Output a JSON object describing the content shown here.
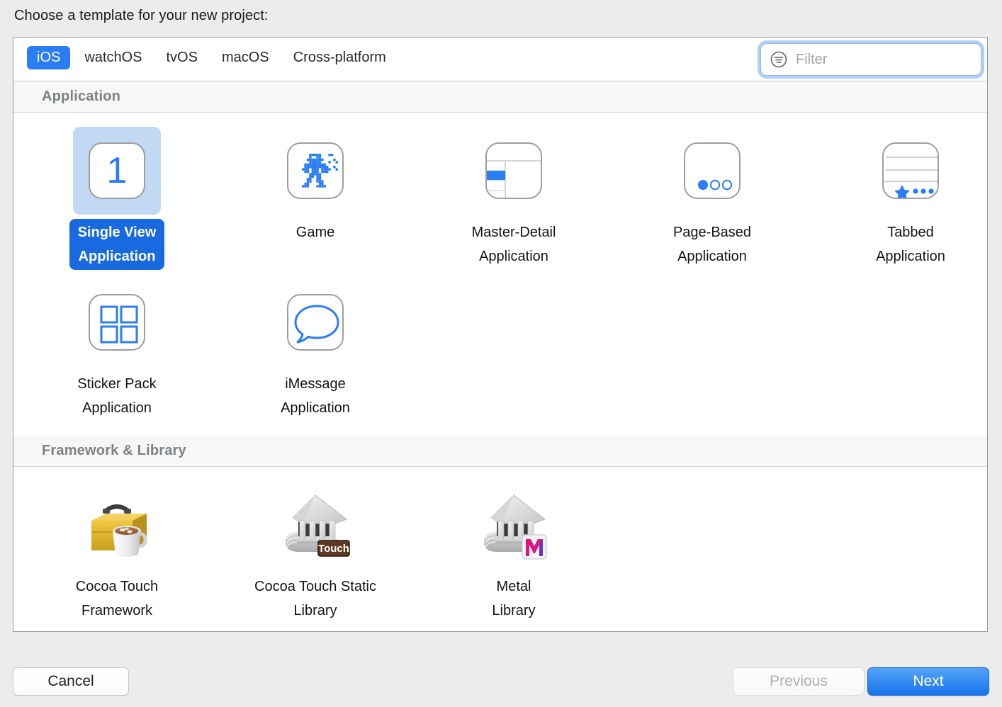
{
  "prompt": "Choose a template for your new project:",
  "toolbar": {
    "tabs": [
      {
        "label": "iOS",
        "active": true
      },
      {
        "label": "watchOS",
        "active": false
      },
      {
        "label": "tvOS",
        "active": false
      },
      {
        "label": "macOS",
        "active": false
      },
      {
        "label": "Cross-platform",
        "active": false
      }
    ],
    "filter": {
      "value": "",
      "placeholder": "Filter",
      "icon": "filter-icon",
      "focused": true
    }
  },
  "accent_color": "#2b7df6",
  "selection_color": "#1969e0",
  "selection_halo_color": "#c3d8f3",
  "groups": [
    {
      "title": "Application",
      "items": [
        {
          "label": "Single View Application",
          "icon": "single-view-icon",
          "selected": true
        },
        {
          "label": "Game",
          "icon": "game-robot-icon",
          "selected": false
        },
        {
          "label": "Master-Detail Application",
          "icon": "master-detail-icon",
          "selected": false
        },
        {
          "label": "Page-Based Application",
          "icon": "page-based-icon",
          "selected": false
        },
        {
          "label": "Tabbed Application",
          "icon": "tabbed-icon",
          "selected": false
        },
        {
          "label": "Sticker Pack Application",
          "icon": "sticker-pack-icon",
          "selected": false
        },
        {
          "label": "iMessage Application",
          "icon": "imessage-icon",
          "selected": false
        }
      ]
    },
    {
      "title": "Framework & Library",
      "items": [
        {
          "label": "Cocoa Touch Framework",
          "icon": "toolbox-cocoa-icon",
          "selected": false
        },
        {
          "label": "Cocoa Touch Static Library",
          "icon": "library-touch-icon",
          "selected": false,
          "badge": "Touch"
        },
        {
          "label": "Metal Library",
          "icon": "library-metal-icon",
          "selected": false,
          "badge": "M"
        }
      ]
    }
  ],
  "footer": {
    "cancel_label": "Cancel",
    "previous_label": "Previous",
    "previous_disabled": true,
    "next_label": "Next",
    "next_default": true
  }
}
